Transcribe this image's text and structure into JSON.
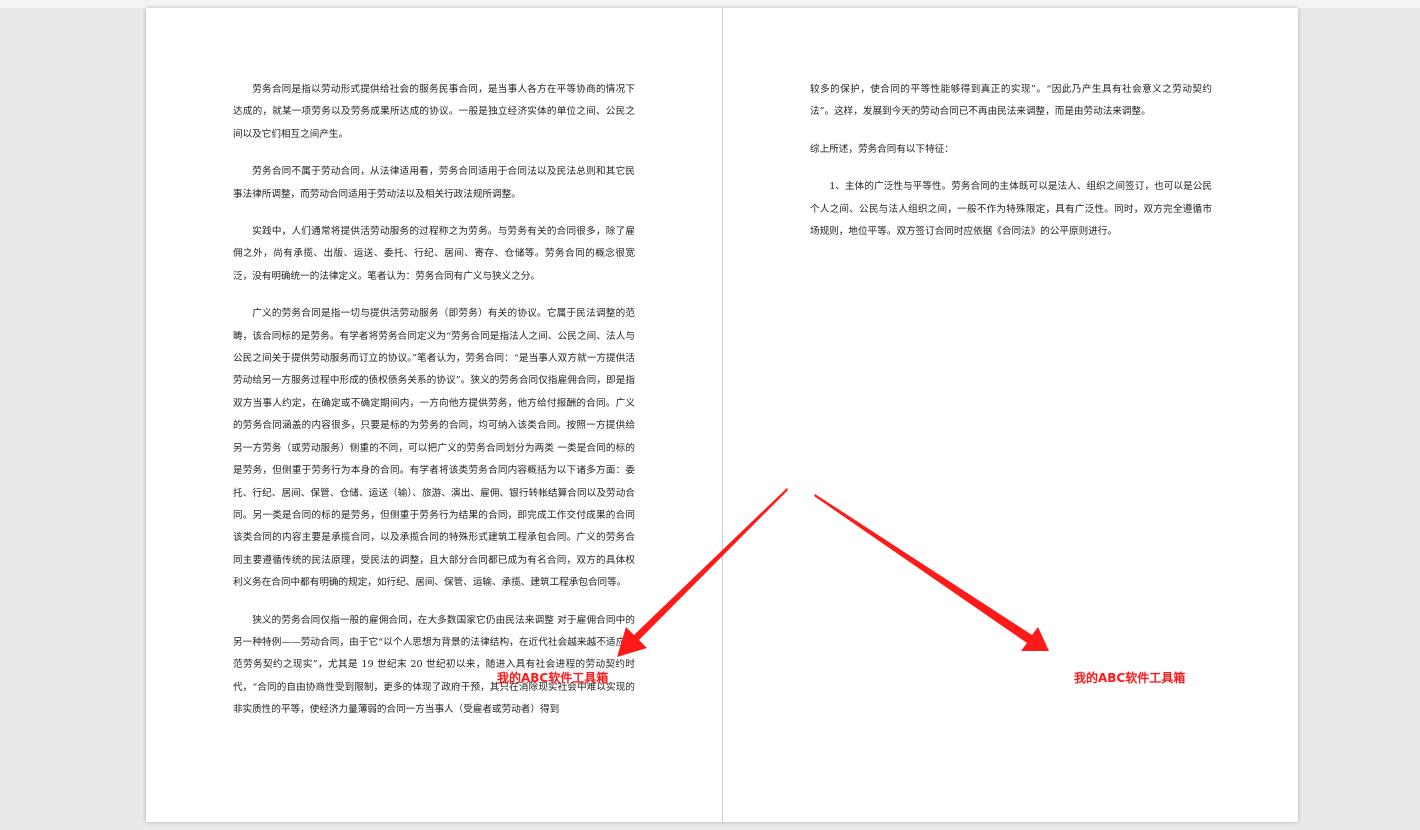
{
  "document": {
    "left_page": {
      "paragraphs": [
        "劳务合同是指以劳动形式提供给社会的服务民事合同，是当事人各方在平等协商的情况下达成的，就某一项劳务以及劳务成果所达成的协议。一般是独立经济实体的单位之间、公民之间以及它们相互之间产生。",
        "劳务合同不属于劳动合同，从法律适用看，劳务合同适用于合同法以及民法总则和其它民事法律所调整，而劳动合同适用于劳动法以及相关行政法规所调整。",
        "实践中，人们通常将提供活劳动服务的过程称之为劳务。与劳务有关的合同很多，除了雇佣之外，尚有承揽、出版、运送、委托、行纪、居间、寄存、仓储等。劳务合同的概念很宽泛，没有明确统一的法律定义。笔者认为：劳务合同有广义与狭义之分。",
        "广义的劳务合同是指一切与提供活劳动服务（即劳务）有关的协议。它属于民法调整的范畴，该合同标的是劳务。有学者将劳务合同定义为“劳务合同是指法人之间、公民之间、法人与公民之间关于提供劳动服务而订立的协议。”笔者认为，劳务合同：“是当事人双方就一方提供活劳动给另一方服务过程中形成的债权债务关系的协议”。狭义的劳务合同仅指雇佣合同，即是指双方当事人约定，在确定或不确定期间内，一方向他方提供劳务，他方给付报酬的合同。广义的劳务合同涵盖的内容很多，只要是标的为劳务的合同，均可纳入该类合同。按照一方提供给另一方劳务（或劳动服务）侧重的不同，可以把广义的劳务合同划分为两类 一类是合同的标的是劳务，但侧重于劳务行为本身的合同。有学者将该类劳务合同内容概括为以下诸多方面：委托、行纪、居间、保管、仓储、运送（输）、旅游、演出、雇佣、银行转帐结算合同以及劳动合同。另一类是合同的标的是劳务，但侧重于劳务行为结果的合同，即完成工作交付成果的合同 该类合同的内容主要是承揽合同，以及承揽合同的特殊形式建筑工程承包合同。广义的劳务合同主要遵循传统的民法原理，受民法的调整，且大部分合同都已成为有名合同，双方的具体权利义务在合同中都有明确的规定，如行纪、居间、保管、运输、承揽、建筑工程承包合同等。",
        "狭义的劳务合同仅指一般的雇佣合同，在大多数国家它仍由民法来调整 对于雇佣合同中的另一种特例——劳动合同，由于它“以个人思想为背景的法律结构，在近代社会越来越不适应规范劳务契约之现实”，尤其是 19 世纪末 20 世纪初以来，随进入具有社会进程的劳动契约时代，“合同的自由协商性受到限制，更多的体现了政府干预，其只在消除现实社会中难以实现的非实质性的平等，使经济力量薄弱的合同一方当事人（受雇者或劳动者）得到"
      ]
    },
    "right_page": {
      "paragraphs": [
        "较多的保护，使合同的平等性能够得到真正的实现”。“因此乃产生具有社会意义之劳动契约法”。这样，发展到今天的劳动合同已不再由民法来调整，而是由劳动法来调整。",
        "综上所述，劳务合同有以下特征：",
        "1、主体的广泛性与平等性。劳务合同的主体既可以是法人、组织之间签订，也可以是公民个人之间、公民与法人组织之间，一般不作为特殊限定，具有广泛性。同时，双方完全遵循市场规则，地位平等。双方签订合同时应依据《合同法》的公平原则进行。"
      ]
    }
  },
  "annotations": {
    "watermark_left": "我的ABC软件工具箱",
    "watermark_right": "我的ABC软件工具箱",
    "arrow_color": "#ff1a1a"
  }
}
